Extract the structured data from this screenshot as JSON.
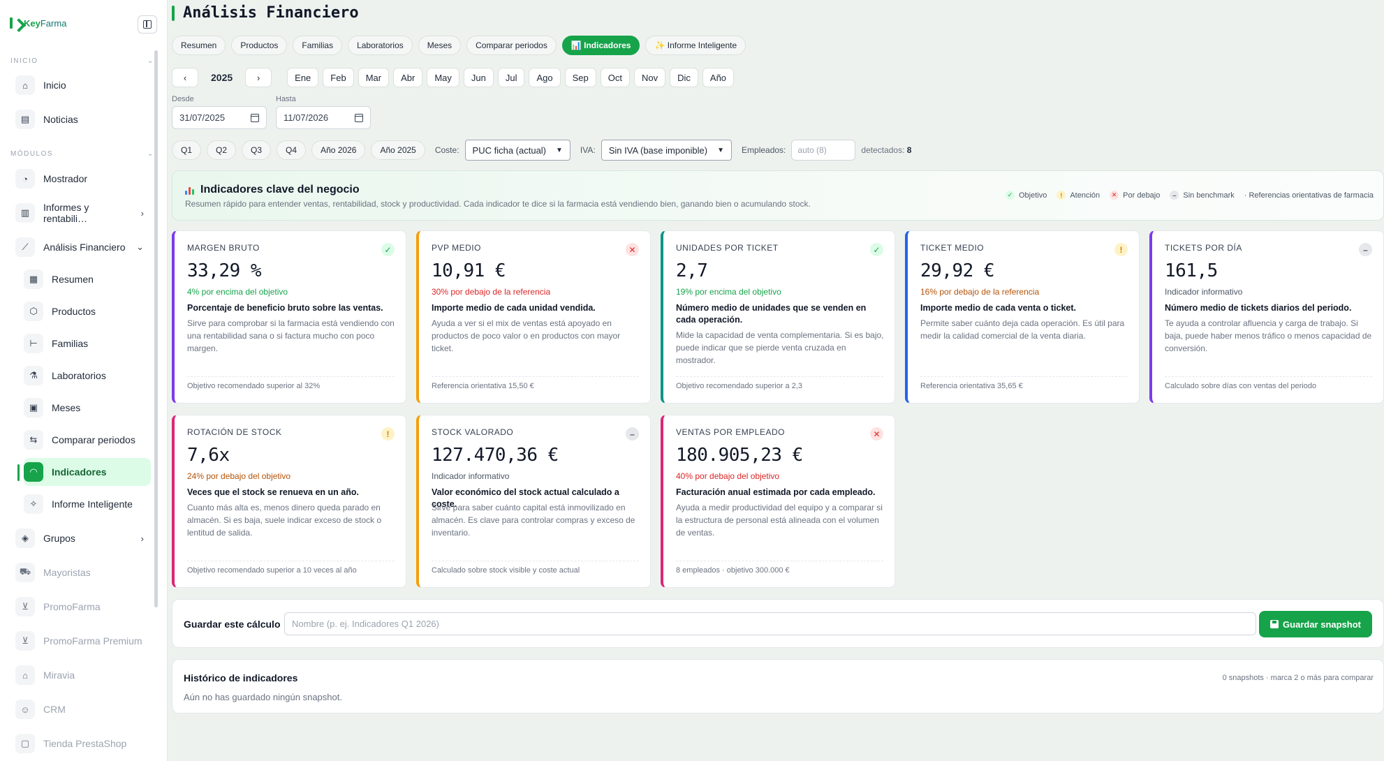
{
  "brand": {
    "name_a": "Key",
    "name_b": "Farma"
  },
  "sidebar": {
    "section_inicio": "INICIO",
    "section_modulos": "MÓDULOS",
    "items": [
      {
        "label": "Inicio",
        "icon": "home-icon"
      },
      {
        "label": "Noticias",
        "icon": "newspaper-icon"
      },
      {
        "label": "Mostrador",
        "icon": "gauge-icon"
      },
      {
        "label": "Informes y rentabili…",
        "icon": "bar-chart-icon"
      },
      {
        "label": "Análisis Financiero",
        "icon": "line-chart-icon"
      },
      {
        "label": "Grupos",
        "icon": "layers-icon"
      },
      {
        "label": "Mayoristas",
        "icon": "truck-icon"
      },
      {
        "label": "PromoFarma",
        "icon": "cart-icon"
      },
      {
        "label": "PromoFarma Premium",
        "icon": "cart-icon"
      },
      {
        "label": "Miravia",
        "icon": "store-icon"
      },
      {
        "label": "CRM",
        "icon": "users-icon"
      },
      {
        "label": "Tienda PrestaShop",
        "icon": "bag-icon"
      }
    ],
    "sub_items": [
      {
        "label": "Resumen",
        "icon": "grid-icon"
      },
      {
        "label": "Productos",
        "icon": "box-icon"
      },
      {
        "label": "Familias",
        "icon": "tree-icon"
      },
      {
        "label": "Laboratorios",
        "icon": "flask-icon"
      },
      {
        "label": "Meses",
        "icon": "calendar-icon"
      },
      {
        "label": "Comparar periodos",
        "icon": "swap-icon"
      },
      {
        "label": "Indicadores",
        "icon": "gauge-icon"
      },
      {
        "label": "Informe Inteligente",
        "icon": "sparkle-icon"
      }
    ]
  },
  "page": {
    "title": "Análisis Financiero"
  },
  "tabs": [
    "Resumen",
    "Productos",
    "Familias",
    "Laboratorios",
    "Meses",
    "Comparar periodos",
    "📊 Indicadores",
    "✨ Informe Inteligente"
  ],
  "year_nav": {
    "prev": "‹",
    "year": "2025",
    "next": "›"
  },
  "months": [
    "Ene",
    "Feb",
    "Mar",
    "Abr",
    "May",
    "Jun",
    "Jul",
    "Ago",
    "Sep",
    "Oct",
    "Nov",
    "Dic",
    "Año"
  ],
  "dates": {
    "from_label": "Desde",
    "from_value": "31/07/2025",
    "to_label": "Hasta",
    "to_value": "11/07/2026"
  },
  "filters": {
    "quick": [
      "Q1",
      "Q2",
      "Q3",
      "Q4",
      "Año 2026",
      "Año 2025"
    ],
    "coste_label": "Coste:",
    "coste_value": "PUC ficha (actual)",
    "iva_label": "IVA:",
    "iva_value": "Sin IVA (base imponible)",
    "empleados_label": "Empleados:",
    "empleados_placeholder": "auto (8)",
    "detected_label": "detectados:",
    "detected_value": "8"
  },
  "kpi_panel": {
    "title": "Indicadores clave del negocio",
    "subtitle": "Resumen rápido para entender ventas, rentabilidad, stock y productividad. Cada indicador te dice si la farmacia está vendiendo bien, ganando bien o acumulando stock.",
    "legend": [
      {
        "symbol": "✓",
        "label": "Objetivo",
        "kind": "ok"
      },
      {
        "symbol": "!",
        "label": "Atención",
        "kind": "warn"
      },
      {
        "symbol": "✕",
        "label": "Por debajo",
        "kind": "bad"
      },
      {
        "symbol": "–",
        "label": "Sin benchmark",
        "kind": "na"
      }
    ],
    "legend_note": "· Referencias orientativas de farmacia"
  },
  "colors": {
    "accent": "#16a34a",
    "purple": "#7c3aed",
    "orange": "#f59e0b",
    "teal": "#0d9488",
    "blue": "#2563eb",
    "pink": "#db2777"
  },
  "cards": [
    {
      "label": "MARGEN BRUTO",
      "value": "33,29 %",
      "status": "4% por encima del objetivo",
      "kind": "ok",
      "symbol": "✓",
      "accent": "#7c3aed",
      "headline": "Porcentaje de beneficio bruto sobre las ventas.",
      "desc": "Sirve para comprobar si la farmacia está vendiendo con una rentabilidad sana o si factura mucho con poco margen.",
      "foot": "Objetivo recomendado superior al 32%"
    },
    {
      "label": "PVP MEDIO",
      "value": "10,91 €",
      "status": "30% por debajo de la referencia",
      "kind": "bad",
      "symbol": "✕",
      "accent": "#f59e0b",
      "headline": "Importe medio de cada unidad vendida.",
      "desc": "Ayuda a ver si el mix de ventas está apoyado en productos de poco valor o en productos con mayor ticket.",
      "foot": "Referencia orientativa 15,50 €"
    },
    {
      "label": "UNIDADES POR TICKET",
      "value": "2,7",
      "status": "19% por encima del objetivo",
      "kind": "ok",
      "symbol": "✓",
      "accent": "#0d9488",
      "headline": "Número medio de unidades que se venden en cada operación.",
      "desc": "Mide la capacidad de venta complementaria. Si es bajo, puede indicar que se pierde venta cruzada en mostrador.",
      "foot": "Objetivo recomendado superior a 2,3"
    },
    {
      "label": "TICKET MEDIO",
      "value": "29,92 €",
      "status": "16% por debajo de la referencia",
      "kind": "warn",
      "symbol": "!",
      "accent": "#2563eb",
      "headline": "Importe medio de cada venta o ticket.",
      "desc": "Permite saber cuánto deja cada operación. Es útil para medir la calidad comercial de la venta diaria.",
      "foot": "Referencia orientativa 35,65 €"
    },
    {
      "label": "TICKETS POR DÍA",
      "value": "161,5",
      "status": "Indicador informativo",
      "kind": "na",
      "symbol": "–",
      "accent": "#7c3aed",
      "headline": "Número medio de tickets diarios del periodo.",
      "desc": "Te ayuda a controlar afluencia y carga de trabajo. Si baja, puede haber menos tráfico o menos capacidad de conversión.",
      "foot": "Calculado sobre días con ventas del periodo"
    },
    {
      "label": "ROTACIÓN DE STOCK",
      "value": "7,6x",
      "status": "24% por debajo del objetivo",
      "kind": "warn",
      "symbol": "!",
      "accent": "#db2777",
      "headline": "Veces que el stock se renueva en un año.",
      "desc": "Cuanto más alta es, menos dinero queda parado en almacén. Si es baja, suele indicar exceso de stock o lentitud de salida.",
      "foot": "Objetivo recomendado superior a 10 veces al año"
    },
    {
      "label": "STOCK VALORADO",
      "value": "127.470,36 €",
      "status": "Indicador informativo",
      "kind": "na",
      "symbol": "–",
      "accent": "#f59e0b",
      "headline": "Valor económico del stock actual calculado a coste.",
      "desc": "Sirve para saber cuánto capital está inmovilizado en almacén. Es clave para controlar compras y exceso de inventario.",
      "foot": "Calculado sobre stock visible y coste actual"
    },
    {
      "label": "VENTAS POR EMPLEADO",
      "value": "180.905,23 €",
      "status": "40% por debajo del objetivo",
      "kind": "bad",
      "symbol": "✕",
      "accent": "#db2777",
      "headline": "Facturación anual estimada por cada empleado.",
      "desc": "Ayuda a medir productividad del equipo y a comparar si la estructura de personal está alineada con el volumen de ventas.",
      "foot": "8 empleados · objetivo 300.000 €"
    }
  ],
  "save": {
    "label": "Guardar este cálculo",
    "placeholder": "Nombre (p. ej. Indicadores Q1 2026)",
    "button": "Guardar snapshot"
  },
  "history": {
    "title": "Histórico de indicadores",
    "meta": "0 snapshots · marca 2 o más para comparar",
    "empty": "Aún no has guardado ningún snapshot."
  }
}
